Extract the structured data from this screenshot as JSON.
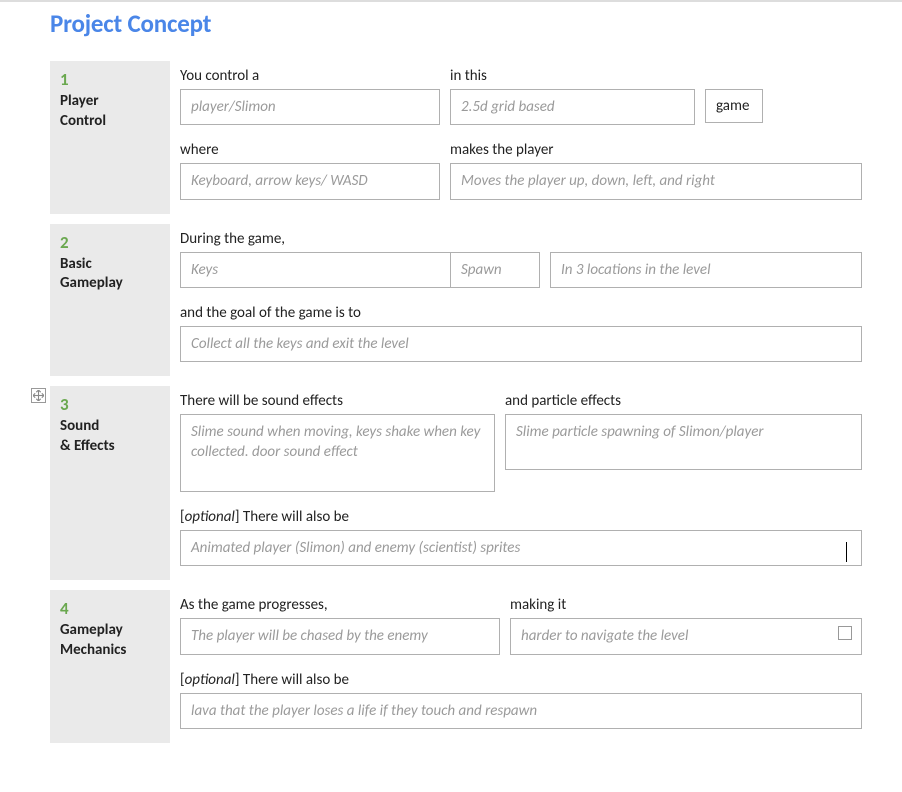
{
  "title": "Project Concept",
  "sections": [
    {
      "num": "1",
      "label_line1": "Player",
      "label_line2": "Control",
      "row1": {
        "label_a": "You control a",
        "value_a": "player/Slimon",
        "label_b": "in this",
        "value_b": "2.5d grid based",
        "suffix": "game"
      },
      "row2": {
        "label_a": "where",
        "value_a": "Keyboard, arrow keys/ WASD",
        "label_b": "makes the player",
        "value_b": "Moves the player up, down, left, and right"
      }
    },
    {
      "num": "2",
      "label_line1": "Basic",
      "label_line2": "Gameplay",
      "row1": {
        "label_a": "During the game,",
        "value_a": "Keys",
        "value_mid": "Spawn",
        "value_b": "In 3 locations in the level"
      },
      "row2": {
        "label_a": "and the goal of the game is to",
        "value_a": "Collect all the keys and exit the level"
      }
    },
    {
      "num": "3",
      "label_line1": "Sound",
      "label_line2": "& Effects",
      "row1": {
        "label_a": "There will be sound effects",
        "value_a": "Slime sound when moving, keys shake when key collected. door sound effect",
        "label_b": "and particle effects",
        "value_b": "Slime particle spawning of Slimon/player"
      },
      "row2": {
        "label_prefix": "[",
        "label_opt": "optional",
        "label_suffix": "] There will also be",
        "value_a": "Animated player (Slimon) and enemy (scientist) sprites"
      }
    },
    {
      "num": "4",
      "label_line1": "Gameplay",
      "label_line2": "Mechanics",
      "row1": {
        "label_a": "As the game progresses,",
        "value_a": "The player will be chased by the enemy",
        "label_b": "making it",
        "value_b": "harder to navigate the level"
      },
      "row2": {
        "label_prefix": "[",
        "label_opt": "optional",
        "label_suffix": "] There will also be",
        "value_a": "lava that the player loses a life if they touch and respawn"
      }
    }
  ]
}
